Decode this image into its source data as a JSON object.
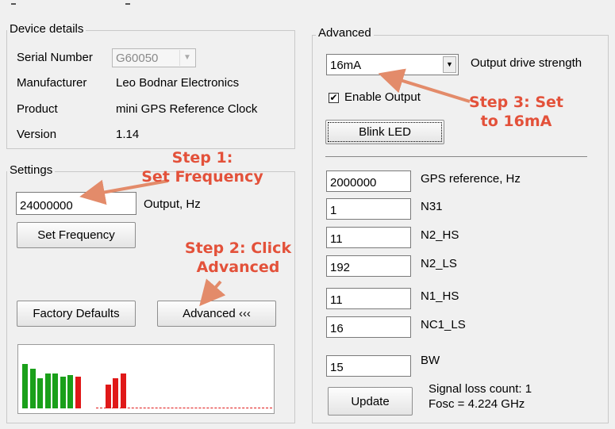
{
  "device": {
    "title": "Device details",
    "serial_label": "Serial Number",
    "serial_value": "G60050",
    "manufacturer_label": "Manufacturer",
    "manufacturer_value": "Leo Bodnar Electronics",
    "product_label": "Product",
    "product_value": "mini GPS Reference Clock",
    "version_label": "Version",
    "version_value": "1.14"
  },
  "settings": {
    "title": "Settings",
    "frequency_value": "24000000",
    "output_label": "Output, Hz",
    "set_frequency_label": "Set Frequency",
    "factory_defaults_label": "Factory Defaults",
    "advanced_label": "Advanced ‹‹‹"
  },
  "advanced": {
    "title": "Advanced",
    "drive_value": "16mA",
    "drive_label": "Output drive strength",
    "enable_output_label": "Enable Output",
    "enable_output_checked": true,
    "blink_led_label": "Blink LED",
    "params": [
      {
        "value": "2000000",
        "label": "GPS reference, Hz"
      },
      {
        "value": "1",
        "label": "N31"
      },
      {
        "value": "11",
        "label": "N2_HS"
      },
      {
        "value": "192",
        "label": "N2_LS"
      },
      {
        "value": "11",
        "label": "N1_HS"
      },
      {
        "value": "16",
        "label": "NC1_LS"
      },
      {
        "value": "15",
        "label": "BW"
      }
    ],
    "update_label": "Update",
    "signal_loss": "Signal loss count: 1",
    "fosc": "Fosc = 4.224 GHz"
  },
  "annotations": {
    "step1_line1": "Step 1:",
    "step1_line2": "Set Frequency",
    "step2_line1": "Step 2: Click",
    "step2_line2": "Advanced",
    "step3_line1": "Step 3: Set",
    "step3_line2": "to 16mA"
  },
  "signal_bars": [
    {
      "level": 0.7,
      "color": "#1aa01a"
    },
    {
      "level": 0.62,
      "color": "#1aa01a"
    },
    {
      "level": 0.48,
      "color": "#1aa01a"
    },
    {
      "level": 0.55,
      "color": "#1aa01a"
    },
    {
      "level": 0.55,
      "color": "#1aa01a"
    },
    {
      "level": 0.5,
      "color": "#1aa01a"
    },
    {
      "level": 0.52,
      "color": "#1aa01a"
    },
    {
      "level": 0.5,
      "color": "#e01818"
    },
    {
      "level": 0.0,
      "color": "#e01818"
    },
    {
      "level": 0.0,
      "color": "#e01818"
    },
    {
      "level": 0.0,
      "color": "#e01818"
    },
    {
      "level": 0.38,
      "color": "#e01818"
    },
    {
      "level": 0.48,
      "color": "#e01818"
    },
    {
      "level": 0.55,
      "color": "#e01818"
    }
  ],
  "colors": {
    "annotation": "#e3513a",
    "good_signal": "#1aa01a",
    "bad_signal": "#e01818"
  }
}
